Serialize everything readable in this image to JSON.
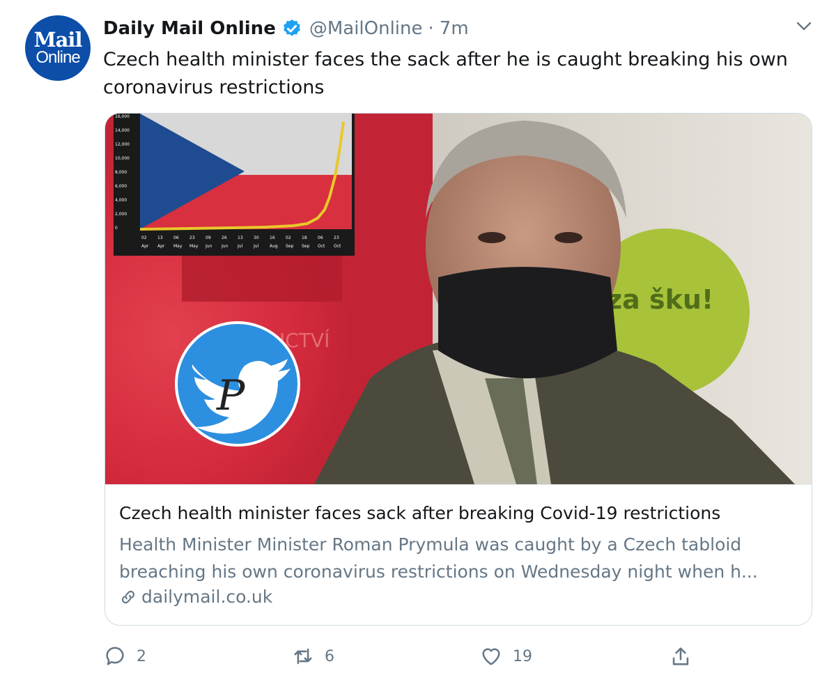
{
  "account": {
    "avatar_line1": "Mail",
    "avatar_line2": "Online",
    "name": "Daily Mail Online",
    "handle": "@MailOnline",
    "separator": "·",
    "time": "7m"
  },
  "tweet": {
    "text": "Czech health minister faces the sack after he is caught breaking his own coronavirus restrictions"
  },
  "card": {
    "image_overlay_text": "za šku!",
    "chart_y_ticks": [
      "16,000",
      "14,000",
      "12,000",
      "10,000",
      "8,000",
      "6,000",
      "4,000",
      "2,000",
      "0"
    ],
    "chart_x_ticks_top": [
      "02",
      "13",
      "06",
      "23",
      "09",
      "26",
      "13",
      "30",
      "16",
      "02",
      "18",
      "06",
      "23"
    ],
    "chart_x_ticks_bottom": [
      "Apr",
      "Apr",
      "May",
      "May",
      "Jun",
      "Jun",
      "Jul",
      "Jul",
      "Aug",
      "Sep",
      "Sep",
      "Oct",
      "Oct"
    ],
    "title": "Czech health minister faces sack after breaking Covid-19 restrictions",
    "description": "Health Minister Minister Roman Prymula was caught by a Czech tabloid breaching his own coronavirus restrictions on Wednesday night when h...",
    "domain": "dailymail.co.uk"
  },
  "actions": {
    "reply_count": "2",
    "retweet_count": "6",
    "like_count": "19"
  },
  "colors": {
    "verified": "#1da1f2",
    "avatar_bg": "#0c4ea8",
    "muted_text": "#657786",
    "chart_line": "#e8c82a"
  },
  "icons": [
    "verified-badge-icon",
    "chevron-down-icon",
    "link-icon",
    "reply-icon",
    "retweet-icon",
    "like-icon",
    "share-icon",
    "twitter-bird-icon"
  ]
}
